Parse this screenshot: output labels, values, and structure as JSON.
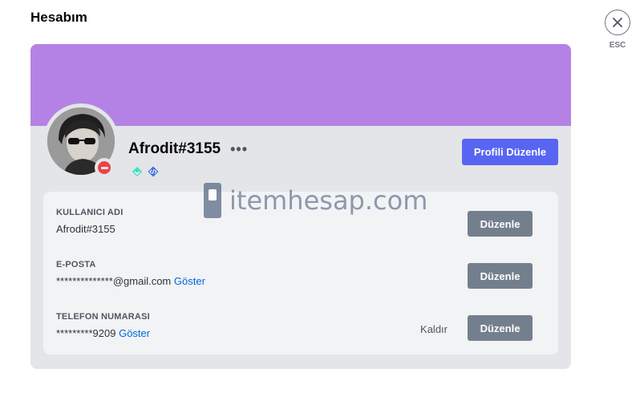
{
  "page": {
    "title": "Hesabım"
  },
  "close": {
    "symbol": "✕",
    "esc_label": "ESC"
  },
  "profile": {
    "username": "Afrodit#3155",
    "more_symbol": "•••",
    "banner_color": "#b482e4",
    "status": "do-not-disturb",
    "status_color": "#ed4245",
    "badges": [
      "hypesquad-balance-icon",
      "active-developer-icon"
    ],
    "edit_profile_label": "Profili Düzenle"
  },
  "fields": {
    "username": {
      "label": "KULLANICI ADI",
      "value": "Afrodit#3155",
      "edit_label": "Düzenle"
    },
    "email": {
      "label": "E-POSTA",
      "value": "**************@gmail.com",
      "reveal_label": "Göster",
      "edit_label": "Düzenle"
    },
    "phone": {
      "label": "TELEFON NUMARASI",
      "value": "*********9209",
      "reveal_label": "Göster",
      "remove_label": "Kaldır",
      "edit_label": "Düzenle"
    }
  },
  "watermark": {
    "text": "itemhesap.com"
  },
  "colors": {
    "brand": "#5865f2",
    "secondary_button": "#747f8d",
    "link": "#0067e0"
  }
}
